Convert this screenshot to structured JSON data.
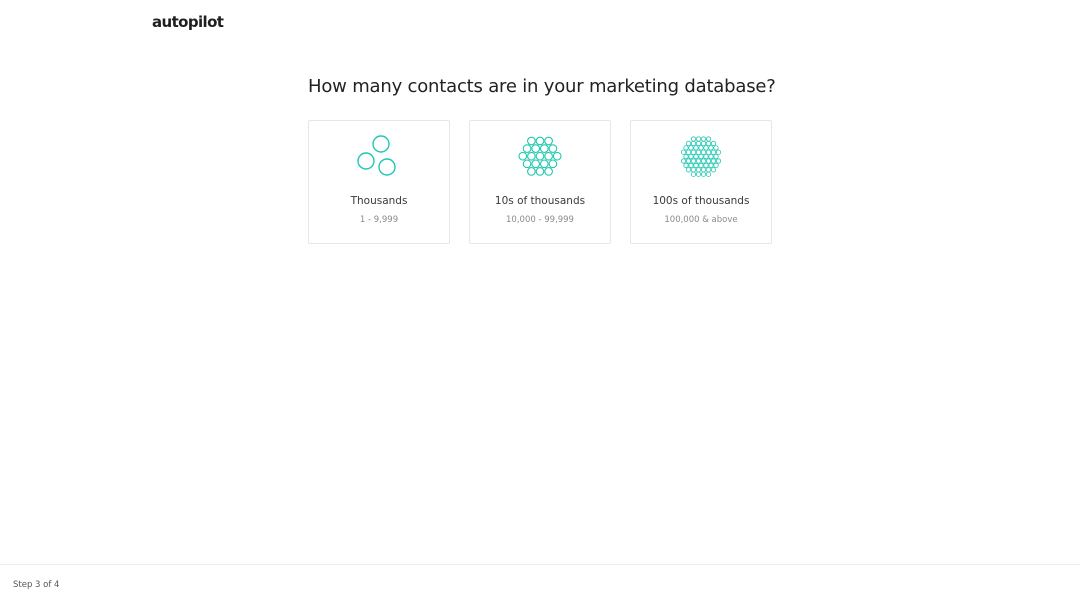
{
  "brand": {
    "logo_text": "autopilot",
    "accent_color": "#1fc8b0"
  },
  "question": {
    "title": "How many contacts are in your marketing database?"
  },
  "options": [
    {
      "icon": "three-circles-icon",
      "title": "Thousands",
      "range": "1 - 9,999"
    },
    {
      "icon": "many-circles-icon",
      "title": "10s of thousands",
      "range": "10,000 - 99,999"
    },
    {
      "icon": "dense-circles-icon",
      "title": "100s of thousands",
      "range": "100,000 & above"
    }
  ],
  "footer": {
    "step_text": "Step 3 of 4"
  }
}
